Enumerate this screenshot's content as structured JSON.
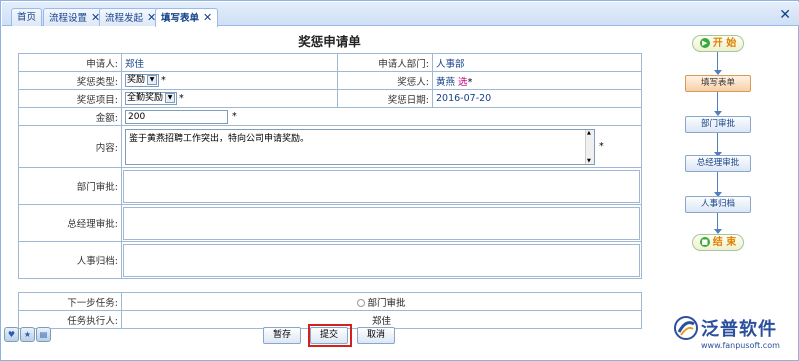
{
  "tabs": [
    {
      "label": "首页",
      "closable": false
    },
    {
      "label": "流程设置",
      "closable": true
    },
    {
      "label": "流程发起",
      "closable": true
    },
    {
      "label": "填写表单",
      "closable": true,
      "active": true
    }
  ],
  "window": {
    "close_icon": "close-icon"
  },
  "form": {
    "title": "奖惩申请单",
    "applicant_label": "申请人:",
    "applicant": "郑佳",
    "dept_label": "申请人部门:",
    "dept": "人事部",
    "type_label": "奖惩类型:",
    "type_value": "奖励",
    "person_label": "奖惩人:",
    "person": "黄燕",
    "pick": "选",
    "item_label": "奖惩项目:",
    "item_value": "全勤奖励",
    "date_label": "奖惩日期:",
    "date": "2016-07-20",
    "amount_label": "金额:",
    "amount": "200",
    "content_label": "内容:",
    "content": "鉴于黄燕招聘工作突出，特向公司申请奖励。",
    "dept_approval_label": "部门审批:",
    "gm_approval_label": "总经理审批:",
    "hr_archive_label": "人事归档:",
    "required_mark": "*"
  },
  "task": {
    "next_label": "下一步任务:",
    "next_value": "部门审批",
    "executor_label": "任务执行人:",
    "executor": "郑佳"
  },
  "buttons": {
    "save": "暂存",
    "submit": "提交",
    "cancel": "取消"
  },
  "flow": {
    "start": "开 始",
    "nodes": [
      "填写表单",
      "部门审批",
      "总经理审批",
      "人事归档"
    ],
    "current": "填写表单",
    "end": "结 束"
  },
  "logo": {
    "name": "泛普软件",
    "url": "www.fanpusoft.com"
  }
}
